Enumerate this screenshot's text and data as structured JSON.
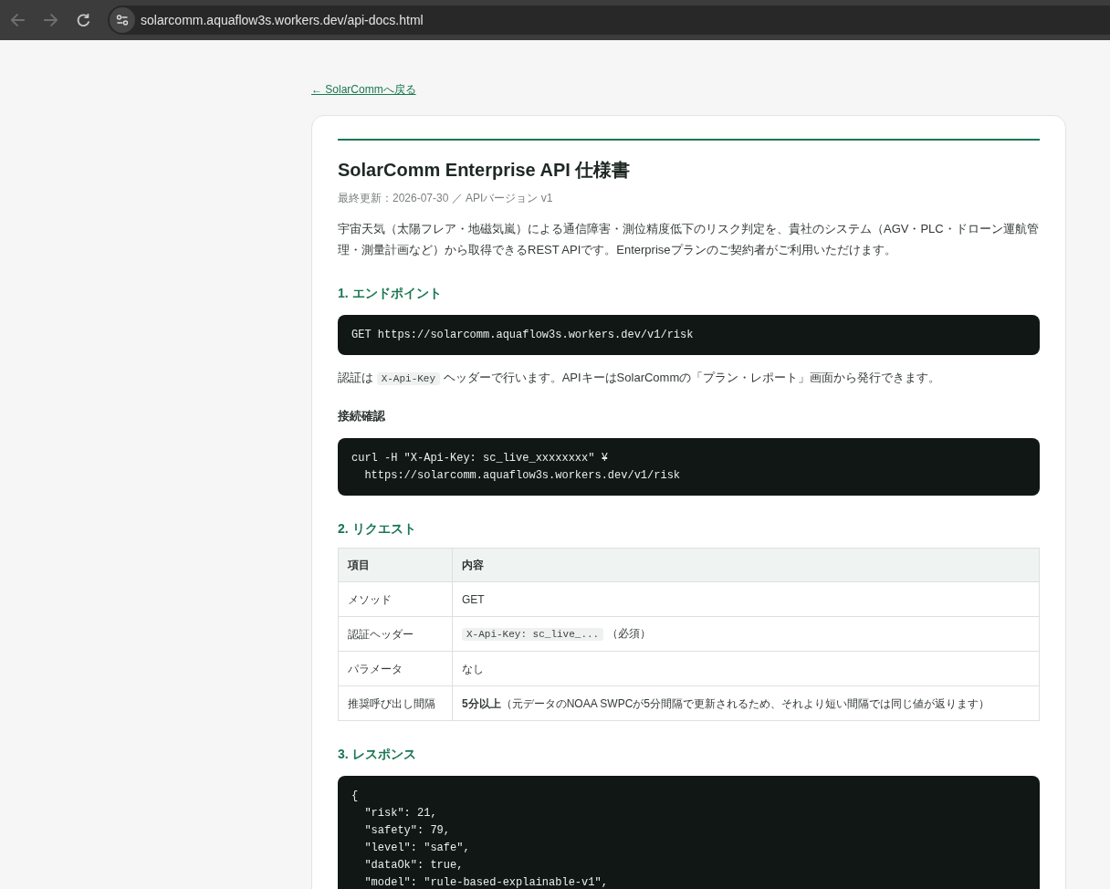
{
  "browser": {
    "nav_buttons": [
      {
        "kind": "back",
        "disabled": true
      },
      {
        "kind": "forward",
        "disabled": true
      },
      {
        "kind": "reload",
        "disabled": false
      }
    ],
    "url": "solarcomm.aquaflow3s.workers.dev/api-docs.html"
  },
  "back_link": "← SolarCommへ戻る",
  "document": {
    "title": "SolarComm Enterprise API 仕様書",
    "meta": "最終更新：2026-07-30 ／ APIバージョン v1",
    "blocks": [
      {
        "kind": "paragraph",
        "parts": [
          {
            "kind": "text",
            "text": "宇宙天気（太陽フレア・地磁気嵐）による通信障害・測位精度低下のリスク判定を、貴社のシステム（AGV・PLC・ドローン運航管理・測量計画など）から取得できるREST APIです。Enterpriseプランのご契約者がご利用いただけます。"
          }
        ]
      },
      {
        "kind": "heading",
        "text": "1. エンドポイント"
      },
      {
        "kind": "code",
        "lines": [
          "GET https://solarcomm.aquaflow3s.workers.dev/v1/risk"
        ]
      },
      {
        "kind": "paragraph",
        "parts": [
          {
            "kind": "text",
            "text": "認証は "
          },
          {
            "kind": "code",
            "text": "X-Api-Key"
          },
          {
            "kind": "text",
            "text": " ヘッダーで行います。APIキーはSolarCommの「プラン・レポート」画面から発行できます。"
          }
        ]
      },
      {
        "kind": "subheading",
        "text": "接続確認"
      },
      {
        "kind": "code",
        "lines": [
          "curl -H \"X-Api-Key: sc_live_xxxxxxxx\" ¥",
          "  https://solarcomm.aquaflow3s.workers.dev/v1/risk"
        ]
      },
      {
        "kind": "heading",
        "text": "2. リクエスト"
      },
      {
        "kind": "table",
        "columns": [
          "項目",
          "内容"
        ],
        "rows": [
          [
            "メソッド",
            "GET"
          ],
          [
            "認証ヘッダー",
            {
              "parts": [
                {
                  "kind": "code",
                  "text": "X-Api-Key: sc_live_..."
                },
                {
                  "kind": "text",
                  "text": " （必須）"
                }
              ]
            }
          ],
          [
            "パラメータ",
            "なし"
          ],
          [
            "推奨呼び出し間隔",
            {
              "parts": [
                {
                  "kind": "text",
                  "text": "**5分以上**（元データのNOAA SWPCが5分間隔で更新されるため、それより短い間隔では同じ値が返ります）"
                }
              ]
            }
          ]
        ]
      },
      {
        "kind": "heading",
        "text": "3. レスポンス"
      },
      {
        "kind": "code",
        "lines": [
          "{",
          "  \"risk\": 21,",
          "  \"safety\": 79,",
          "  \"level\": \"safe\",",
          "  \"dataOk\": true,",
          "  \"model\": \"rule-based-explainable-v1\","
        ]
      }
    ]
  }
}
